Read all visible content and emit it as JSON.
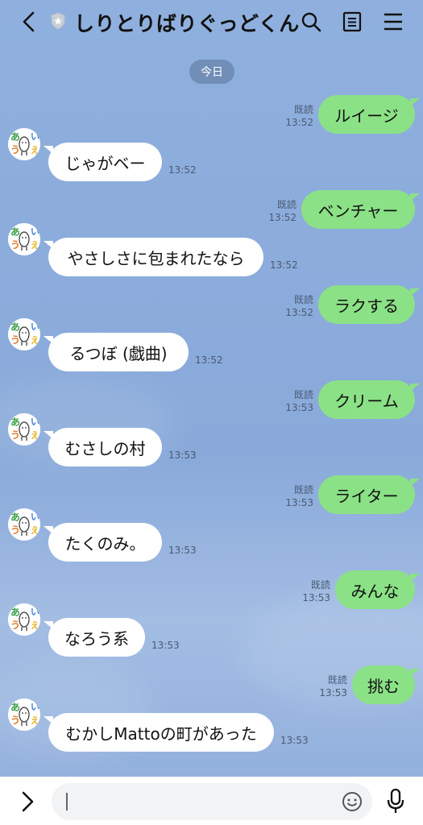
{
  "header": {
    "title": "しりとりばりぐっどくん"
  },
  "date_divider": "今日",
  "messages": [
    {
      "side": "me",
      "text": "ルイージ",
      "read": "既読",
      "time": "13:52"
    },
    {
      "side": "other",
      "text": "じゃがベー",
      "time": "13:52"
    },
    {
      "side": "me",
      "text": "ベンチャー",
      "read": "既読",
      "time": "13:52"
    },
    {
      "side": "other",
      "text": "やさしさに包まれたなら",
      "time": "13:52"
    },
    {
      "side": "me",
      "text": "ラクする",
      "read": "既読",
      "time": "13:52"
    },
    {
      "side": "other",
      "text": "るつぼ (戯曲)",
      "time": "13:52"
    },
    {
      "side": "me",
      "text": "クリーム",
      "read": "既読",
      "time": "13:53"
    },
    {
      "side": "other",
      "text": "むさしの村",
      "time": "13:53"
    },
    {
      "side": "me",
      "text": "ライター",
      "read": "既読",
      "time": "13:53"
    },
    {
      "side": "other",
      "text": "たくのみ。",
      "time": "13:53"
    },
    {
      "side": "me",
      "text": "みんな",
      "read": "既読",
      "time": "13:53"
    },
    {
      "side": "other",
      "text": "なろう系",
      "time": "13:53"
    },
    {
      "side": "me",
      "text": "挑む",
      "read": "既読",
      "time": "13:53"
    },
    {
      "side": "other",
      "text": "むかしMattoの町があった",
      "time": "13:53"
    }
  ],
  "input": {
    "value": "",
    "placeholder": ""
  },
  "colors": {
    "background": "#8aaadc",
    "my_bubble": "#8be186",
    "their_bubble": "#ffffff",
    "input_bar": "#ffffff"
  },
  "icons": {
    "back": "chevron-left-icon",
    "shield": "shield-star-icon",
    "search": "search-icon",
    "notes": "notes-icon",
    "menu": "menu-icon",
    "expand": "chevron-right-icon",
    "emoji": "emoji-icon",
    "mic": "microphone-icon"
  }
}
